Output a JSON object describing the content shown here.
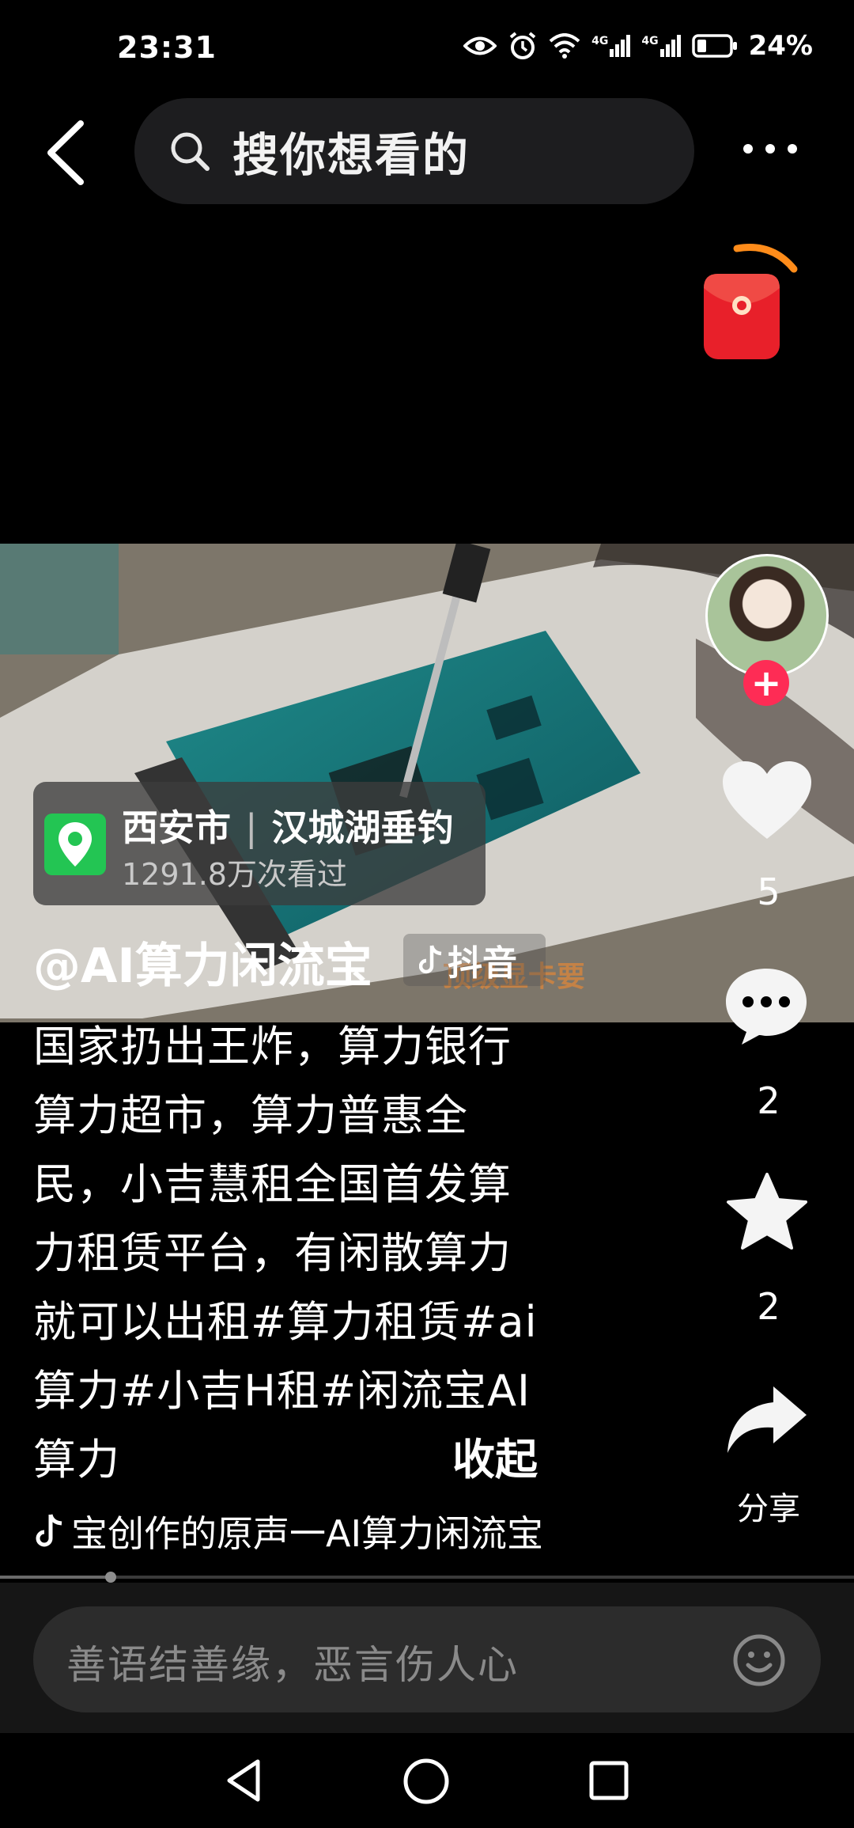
{
  "status_bar": {
    "time": "23:31",
    "battery": "24%",
    "network_1": "4G",
    "network_2": "4G"
  },
  "header": {
    "search_placeholder": "搜你想看的",
    "back_icon": "chevron-left-icon",
    "more_icon": "more-dots-icon"
  },
  "video": {
    "location": {
      "city": "西安市",
      "place": "汉城湖垂钓",
      "views": "1291.8万次看过"
    },
    "author": "@AI算力闲流宝",
    "watermark": "抖音",
    "overlay_subtitle": "顶级显卡要",
    "caption_lines": [
      "国家扔出王炸，算力银行",
      "算力超市，算力普惠全",
      "民，小吉慧租全国首发算",
      "力租赁平台，有闲散算力",
      "就可以出租#算力租赁#ai",
      "算力#小吉H租#闲流宝AI",
      "算力"
    ],
    "collapse_label": "收起",
    "music": "宝创作的原声一AI算力闲流宝",
    "progress": 0.13
  },
  "actions": {
    "likes": "5",
    "comments": "2",
    "favorites": "2",
    "share_label": "分享"
  },
  "comment_bar": {
    "placeholder": "善语结善缘，恶言伤人心"
  },
  "colors": {
    "background": "#000000",
    "accent_red": "#fe2c55",
    "location_green": "#23c553",
    "packet_red": "#e8202a"
  }
}
